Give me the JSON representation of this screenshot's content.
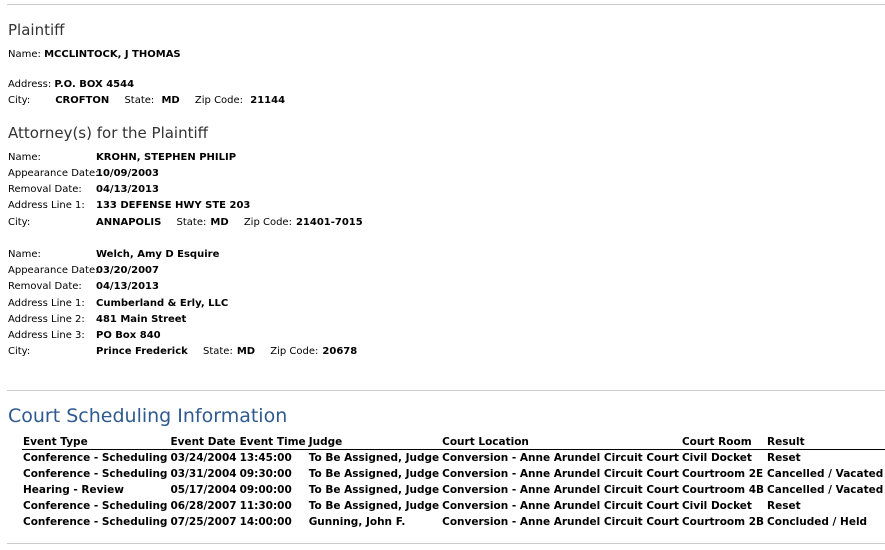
{
  "plaintiff": {
    "title": "Plaintiff",
    "name_label": "Name:",
    "name": "MCCLINTOCK, J THOMAS",
    "address_label": "Address:",
    "address": "P.O. BOX 4544",
    "city_label": "City:",
    "city": "CROFTON",
    "state_label": "State:",
    "state": "MD",
    "zip_label": "Zip Code:",
    "zip": "21144"
  },
  "attorneys": {
    "title": "Attorney(s) for the Plaintiff",
    "list": [
      {
        "name_label": "Name:",
        "name": "KROHN, STEPHEN PHILIP",
        "appearance_label": "Appearance Date:",
        "appearance": "10/09/2003",
        "removal_label": "Removal Date:",
        "removal": "04/13/2013",
        "addr1_label": "Address Line 1:",
        "addr1": "133 DEFENSE HWY STE 203",
        "city_label": "City:",
        "city": "ANNAPOLIS",
        "state_label": "State:",
        "state": "MD",
        "zip_label": "Zip Code:",
        "zip": "21401-7015"
      },
      {
        "name_label": "Name:",
        "name": "Welch, Amy D Esquire",
        "appearance_label": "Appearance Date:",
        "appearance": "03/20/2007",
        "removal_label": "Removal Date:",
        "removal": "04/13/2013",
        "addr1_label": "Address Line 1:",
        "addr1": "Cumberland & Erly, LLC",
        "addr2_label": "Address Line 2:",
        "addr2": "481 Main Street",
        "addr3_label": "Address Line 3:",
        "addr3": "PO Box 840",
        "city_label": "City:",
        "city": "Prince Frederick",
        "state_label": "State:",
        "state": "MD",
        "zip_label": "Zip Code:",
        "zip": "20678"
      }
    ]
  },
  "scheduling": {
    "title": "Court Scheduling Information",
    "headers": [
      "Event Type",
      "Event Date",
      "Event Time",
      "Judge",
      "Court Location",
      "Court Room",
      "Result"
    ],
    "rows": [
      [
        "Conference - Scheduling",
        "03/24/2004",
        "13:45:00",
        "To Be Assigned, Judge",
        "Conversion - Anne Arundel Circuit Court",
        "Civil Docket",
        "Reset"
      ],
      [
        "Conference - Scheduling",
        "03/31/2004",
        "09:30:00",
        "To Be Assigned, Judge",
        "Conversion - Anne Arundel Circuit Court",
        "Courtroom 2E",
        "Cancelled / Vacated"
      ],
      [
        "Hearing - Review",
        "05/17/2004",
        "09:00:00",
        "To Be Assigned, Judge",
        "Conversion - Anne Arundel Circuit Court",
        "Courtroom 4B",
        "Cancelled / Vacated"
      ],
      [
        "Conference - Scheduling",
        "06/28/2007",
        "11:30:00",
        "To Be Assigned, Judge",
        "Conversion - Anne Arundel Circuit Court",
        "Civil Docket",
        "Reset"
      ],
      [
        "Conference - Scheduling",
        "07/25/2007",
        "14:00:00",
        "Gunning, John F.",
        "Conversion - Anne Arundel Circuit Court",
        "Courtroom 2B",
        "Concluded / Held"
      ]
    ]
  }
}
